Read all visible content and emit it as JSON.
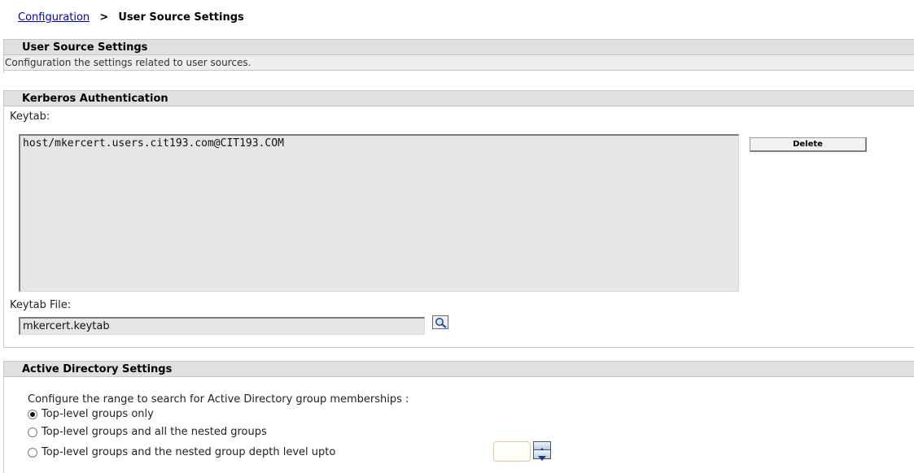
{
  "breadcrumb": {
    "link": "Configuration",
    "separator": ">",
    "current": "User Source Settings"
  },
  "user_source": {
    "title": "User Source Settings",
    "description": "Configuration the settings related to user sources."
  },
  "kerberos": {
    "title": "Kerberos Authentication",
    "keytab_label": "Keytab:",
    "keytab_value": "host/mkercert.users.cit193.com@CIT193.COM",
    "delete_label": "Delete",
    "keytab_file_label": "Keytab File:",
    "keytab_file_value": "mkercert.keytab",
    "browse_icon": "magnifier-icon"
  },
  "active_directory": {
    "title": "Active Directory Settings",
    "prompt": "Configure the range to search for Active Directory group memberships :",
    "options": [
      {
        "label": "Top-level groups only",
        "checked": true
      },
      {
        "label": "Top-level groups and all the nested groups",
        "checked": false
      },
      {
        "label": "Top-level groups and the nested group depth level upto",
        "checked": false
      }
    ],
    "depth_value": ""
  },
  "colors": {
    "link": "#0000c0",
    "header_bg": "#e0e0e0",
    "field_bg": "#e6e6e6"
  }
}
